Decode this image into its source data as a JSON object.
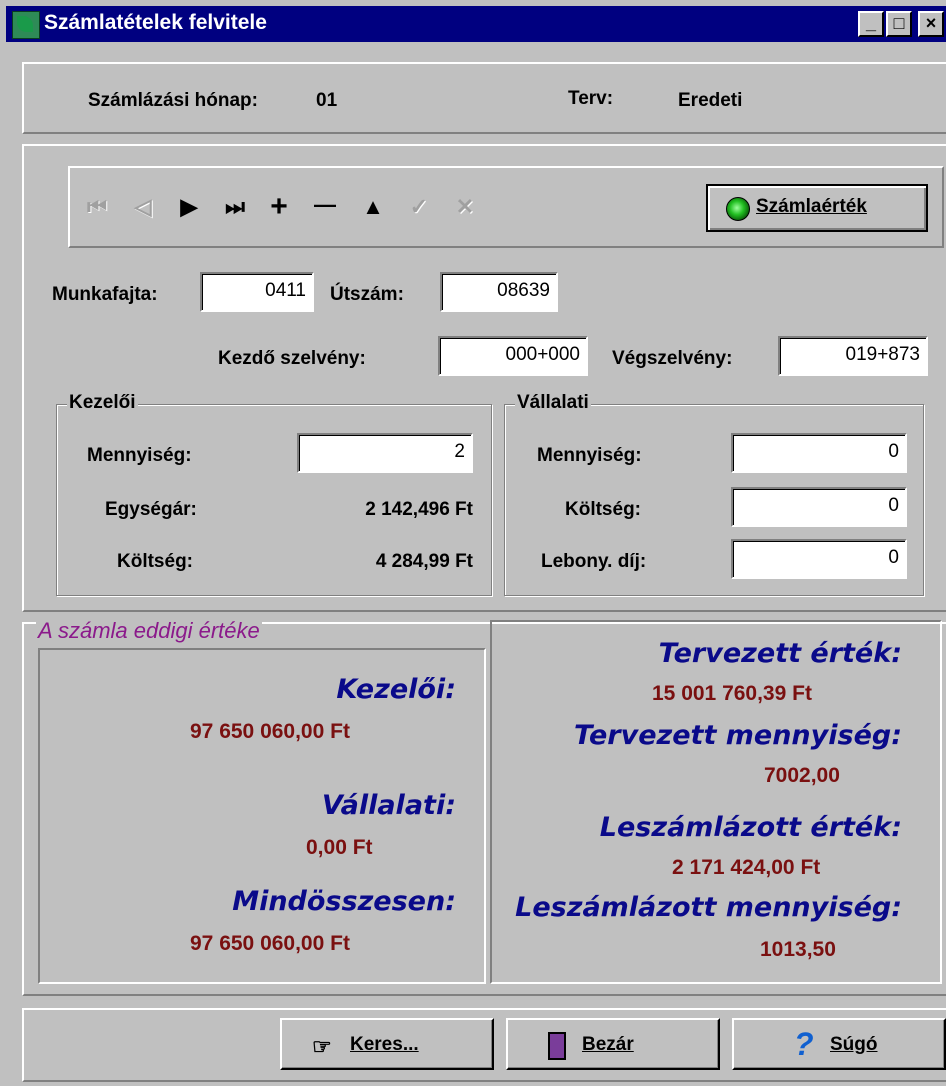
{
  "window": {
    "title": "Számlatételek felvitele",
    "controls": {
      "minimize": "_",
      "maximize": "□",
      "close": "×"
    }
  },
  "header": {
    "month_label": "Számlázási hónap:",
    "month_value": "01",
    "plan_label": "Terv:",
    "plan_value": "Eredeti"
  },
  "navigator": {
    "first": "⏮",
    "prior": "◁",
    "next": "▶",
    "last": "⏭",
    "insert": "+",
    "delete": "—",
    "edit": "▲",
    "post": "✓",
    "cancel": "✕",
    "invoice_value_button": "Számlaérték"
  },
  "form": {
    "work_type_label": "Munkafajta:",
    "work_type_value": "0411",
    "road_number_label": "Útszám:",
    "road_number_value": "08639",
    "start_section_label": "Kezdő szelvény:",
    "start_section_value": "000+000",
    "end_section_label": "Végszelvény:",
    "end_section_value": "019+873"
  },
  "operator_group": {
    "title": "Kezelői",
    "quantity_label": "Mennyiség:",
    "quantity_value": "2",
    "unit_price_label": "Egységár:",
    "unit_price_value": "2 142,496 Ft",
    "cost_label": "Költség:",
    "cost_value": "4 284,99 Ft"
  },
  "company_group": {
    "title": "Vállalati",
    "quantity_label": "Mennyiség:",
    "quantity_value": "0",
    "cost_label": "Költség:",
    "cost_value": "0",
    "fee_label": "Lebony. díj:",
    "fee_value": "0"
  },
  "invoice_summary": {
    "title": "A számla eddigi értéke",
    "operator_label": "Kezelői:",
    "operator_value": "97 650 060,00 Ft",
    "company_label": "Vállalati:",
    "company_value": "0,00 Ft",
    "total_label": "Mindösszesen:",
    "total_value": "97 650 060,00 Ft",
    "planned_value_label": "Tervezett érték:",
    "planned_value": "15 001 760,39 Ft",
    "planned_qty_label": "Tervezett mennyiség:",
    "planned_qty": "7002,00",
    "invoiced_value_label": "Leszámlázott érték:",
    "invoiced_value": "2 171 424,00 Ft",
    "invoiced_qty_label": "Leszámlázott mennyiség:",
    "invoiced_qty": "1013,50"
  },
  "footer": {
    "search_button": "Keres...",
    "close_button": "Bezár",
    "help_button": "Súgó"
  },
  "colors": {
    "titlebar": "#000080",
    "face": "#c0c0c0",
    "summary_title": "#8b1a8b",
    "fancy_label": "#0a0a8a",
    "money": "#7a1010"
  }
}
